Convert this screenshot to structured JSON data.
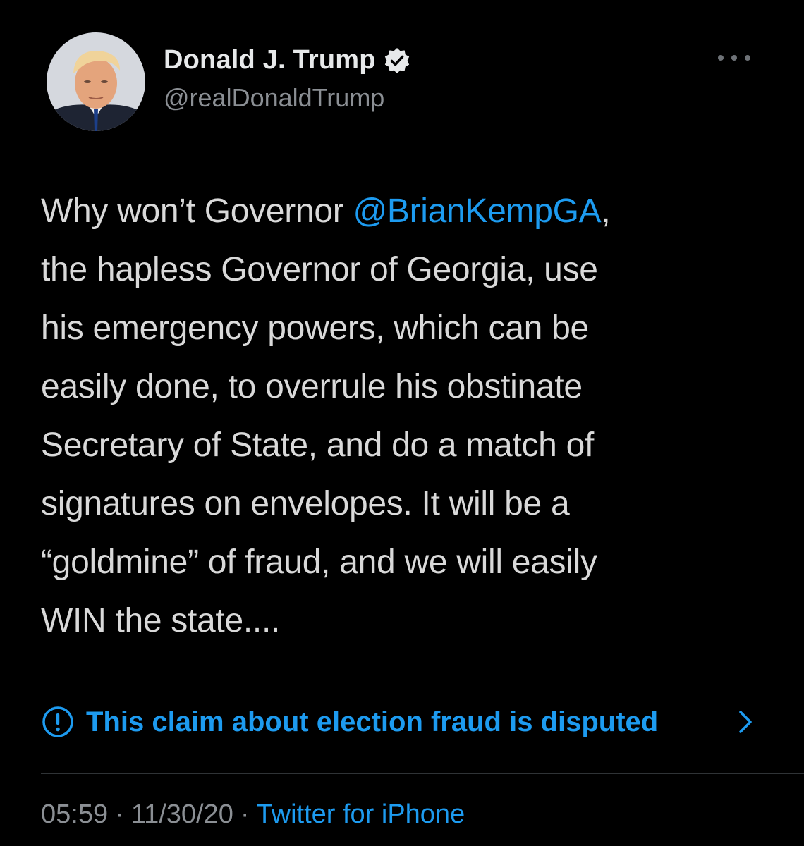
{
  "author": {
    "display_name": "Donald J. Trump",
    "handle": "@realDonaldTrump",
    "verified": true,
    "avatar_icon": "profile-photo"
  },
  "tweet": {
    "lines": [
      {
        "before": "Why won’t Governor ",
        "mention": "@BrianKempGA",
        "after": ","
      },
      {
        "text": "the hapless Governor of Georgia, use"
      },
      {
        "text": "his emergency powers, which can be"
      },
      {
        "text": "easily done, to overrule his obstinate"
      },
      {
        "text": "Secretary of State, and do a match of"
      },
      {
        "text": "signatures on envelopes. It will be a"
      },
      {
        "text": "“goldmine” of fraud, and we will easily"
      },
      {
        "text": "WIN the state...."
      }
    ]
  },
  "notice": {
    "icon": "exclamation-circle-icon",
    "label": "This claim about election fraud is disputed"
  },
  "meta": {
    "time": "05:59",
    "separator": "·",
    "date": "11/30/20",
    "source": "Twitter for iPhone"
  },
  "colors": {
    "background": "#000000",
    "text": "#d9d9d9",
    "link": "#1d9bf0",
    "secondary": "#8b8f94"
  }
}
